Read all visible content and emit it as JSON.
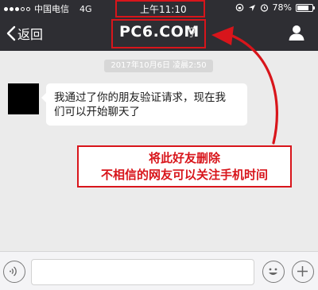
{
  "status_bar": {
    "carrier": "中国电信",
    "network": "4G",
    "time": "上午11:10",
    "battery": "78%",
    "battery_level": 0.78
  },
  "nav": {
    "back_label": "返回",
    "title": "PC6.COM"
  },
  "chat": {
    "timestamp": "2017年10月6日 凌晨2:50",
    "messages": [
      {
        "text_line1": "我通过了你的朋友验证请求，现在我",
        "text_line2": "们可以开始聊天了"
      }
    ]
  },
  "annotation": {
    "line1": "将此好友删除",
    "line2": "不相信的网友可以关注手机时间",
    "color": "#d8151b"
  },
  "input": {
    "placeholder": ""
  },
  "colors": {
    "topbar": "#2e2e33",
    "chat_bg": "#ebebeb",
    "accent_red": "#d8151b"
  }
}
